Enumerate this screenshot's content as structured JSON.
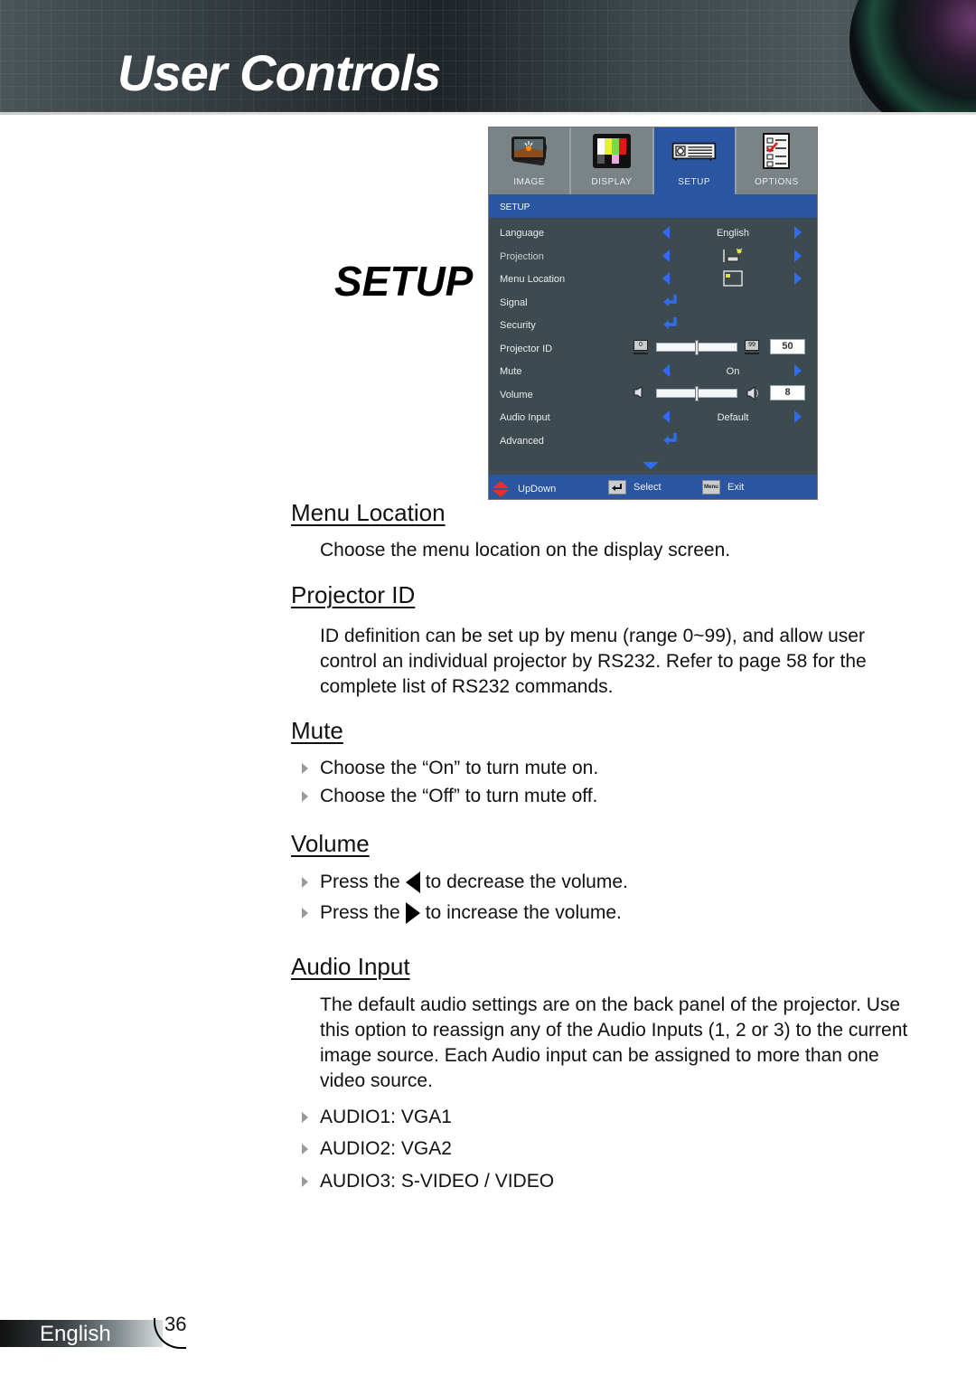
{
  "header": {
    "title": "User Controls"
  },
  "section_tag": "SETUP",
  "osd": {
    "tabs": [
      {
        "label": "IMAGE",
        "icon": "image-photo-icon",
        "active": false
      },
      {
        "label": "DISPLAY",
        "icon": "display-colorbars-icon",
        "active": false
      },
      {
        "label": "SETUP",
        "icon": "projector-icon",
        "active": true
      },
      {
        "label": "OPTIONS",
        "icon": "checklist-icon",
        "active": false
      }
    ],
    "heading": "SETUP",
    "rows": [
      {
        "label": "Language",
        "type": "select",
        "value": "English"
      },
      {
        "label": "Projection",
        "type": "select",
        "value_icon": "front-projection-icon"
      },
      {
        "label": "Menu Location",
        "type": "select",
        "value_icon": "menu-top-left-icon"
      },
      {
        "label": "Signal",
        "type": "enter"
      },
      {
        "label": "Security",
        "type": "enter"
      },
      {
        "label": "Projector ID",
        "type": "slider",
        "min_label": "0",
        "max_label": "99",
        "value": "50",
        "fraction": 0.5
      },
      {
        "label": "Mute",
        "type": "select",
        "value": "On"
      },
      {
        "label": "Volume",
        "type": "slider",
        "value": "8",
        "fraction": 0.5
      },
      {
        "label": "Audio Input",
        "type": "select",
        "value": "Default"
      },
      {
        "label": "Advanced",
        "type": "enter"
      }
    ],
    "footer": {
      "updown": "UpDown",
      "select": "Select",
      "exit": "Exit",
      "menu_key": "Menu"
    }
  },
  "sections": {
    "menu_location": {
      "title": "Menu Location",
      "text": "Choose the menu location on the display screen."
    },
    "projector_id": {
      "title": "Projector ID",
      "text": "ID definition can be set up by menu (range 0~99), and allow user control an individual projector by RS232. Refer to page 58 for the complete list of RS232 commands."
    },
    "mute": {
      "title": "Mute",
      "bullets": [
        "Choose the “On” to turn mute on.",
        "Choose the “Off” to turn mute off."
      ]
    },
    "volume": {
      "title": "Volume",
      "bullet1_pre": "Press the",
      "bullet1_post": "to decrease the volume.",
      "bullet2_pre": "Press the",
      "bullet2_post": "to increase the volume."
    },
    "audio_input": {
      "title": "Audio Input",
      "text": "The default audio settings are on the back panel of the projector. Use this option to reassign any of the Audio Inputs (1, 2 or 3) to the current image source. Each Audio input can be assigned to more than one video source.",
      "bullets": [
        "AUDIO1: VGA1",
        "AUDIO2: VGA2",
        "AUDIO3: S-VIDEO / VIDEO"
      ]
    }
  },
  "footer": {
    "language": "English",
    "page": "36"
  },
  "colors": {
    "osd_accent": "#2a55a0",
    "osd_arrow": "#2f6cf0",
    "osd_bg": "#3d4a4f"
  }
}
